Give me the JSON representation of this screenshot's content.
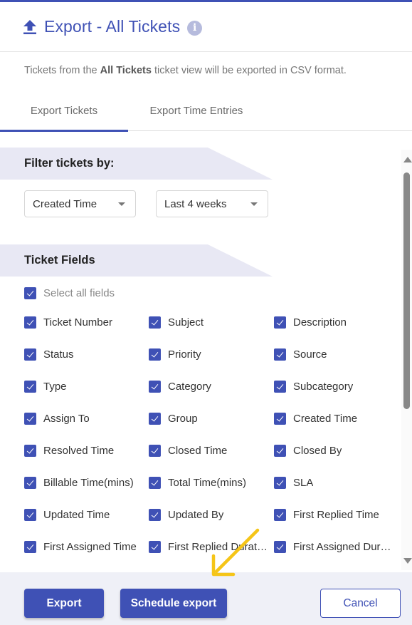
{
  "header": {
    "title": "Export - All Tickets",
    "upload_icon": "upload-icon",
    "info_icon": "info-icon",
    "info_glyph": "i"
  },
  "description": {
    "prefix": "Tickets from the ",
    "view_name": "All Tickets",
    "suffix": " ticket view will be exported in CSV format."
  },
  "tabs": [
    {
      "label": "Export Tickets",
      "active": true
    },
    {
      "label": "Export Time Entries",
      "active": false
    }
  ],
  "filter": {
    "heading": "Filter tickets by:",
    "field_select": {
      "value": "Created Time"
    },
    "range_select": {
      "value": "Last 4 weeks"
    }
  },
  "ticket_fields": {
    "heading": "Ticket Fields",
    "select_all": {
      "label": "Select all fields",
      "checked": true
    },
    "fields": [
      {
        "label": "Ticket Number",
        "checked": true
      },
      {
        "label": "Subject",
        "checked": true
      },
      {
        "label": "Description",
        "checked": true
      },
      {
        "label": "Status",
        "checked": true
      },
      {
        "label": "Priority",
        "checked": true
      },
      {
        "label": "Source",
        "checked": true
      },
      {
        "label": "Type",
        "checked": true
      },
      {
        "label": "Category",
        "checked": true
      },
      {
        "label": "Subcategory",
        "checked": true
      },
      {
        "label": "Assign To",
        "checked": true
      },
      {
        "label": "Group",
        "checked": true
      },
      {
        "label": "Created Time",
        "checked": true
      },
      {
        "label": "Resolved Time",
        "checked": true
      },
      {
        "label": "Closed Time",
        "checked": true
      },
      {
        "label": "Closed By",
        "checked": true
      },
      {
        "label": "Billable Time(mins)",
        "checked": true
      },
      {
        "label": "Total Time(mins)",
        "checked": true
      },
      {
        "label": "SLA",
        "checked": true
      },
      {
        "label": "Updated Time",
        "checked": true
      },
      {
        "label": "Updated By",
        "checked": true
      },
      {
        "label": "First Replied Time",
        "checked": true
      },
      {
        "label": "First Assigned Time",
        "checked": true
      },
      {
        "label": "First Replied Durat…",
        "checked": true
      },
      {
        "label": "First Assigned Dur…",
        "checked": true
      }
    ]
  },
  "footer": {
    "export_label": "Export",
    "schedule_label": "Schedule export",
    "cancel_label": "Cancel"
  },
  "colors": {
    "accent": "#3f51b5",
    "banner": "#e8e8f4",
    "footer_bg": "#eff0f7",
    "annotation_arrow": "#f5c518"
  }
}
